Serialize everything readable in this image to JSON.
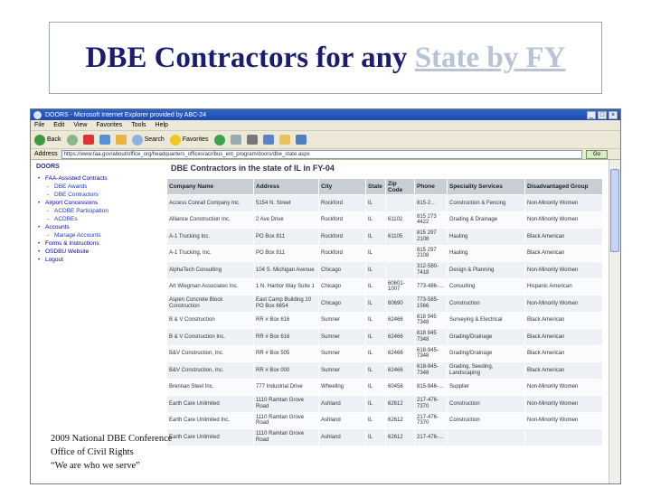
{
  "slide": {
    "title_prefix": "DBE Contractors for any",
    "title_link": "State by FY",
    "footer": [
      "2009 National DBE Conference",
      "Office of Civil Rights",
      "“We are who we serve”"
    ]
  },
  "browser": {
    "window_title": "DOORS - Microsoft Internet Explorer provided by ABC-24",
    "menu": [
      "File",
      "Edit",
      "View",
      "Favorites",
      "Tools",
      "Help"
    ],
    "toolbar": {
      "back": "Back",
      "search": "Search",
      "favorites": "Favorites"
    },
    "address_label": "Address",
    "address": "https://www.faa.gov/about/office_org/headquarters_offices/acr/bus_ent_program/doors/dbe_state.aspx",
    "go_label": "Go"
  },
  "nav": {
    "logo": "DOORS",
    "items": [
      {
        "label": "FAA-Assisted Contracts",
        "sub": false
      },
      {
        "label": "DBE Awards",
        "sub": true
      },
      {
        "label": "DBE Contractors",
        "sub": true
      },
      {
        "label": "Airport Concessions",
        "sub": false
      },
      {
        "label": "ACDBE Participation",
        "sub": true
      },
      {
        "label": "ACDBEs",
        "sub": true
      },
      {
        "label": "Accounts",
        "sub": false
      },
      {
        "label": "Manage Accounts",
        "sub": true
      },
      {
        "label": "Forms & Instructions",
        "sub": false
      },
      {
        "label": "OSDBU Website",
        "sub": false
      },
      {
        "label": "Logout",
        "sub": false
      }
    ]
  },
  "page_heading": "DBE Contractors in the state of IL in FY-04",
  "table": {
    "headers": [
      "Company Name",
      "Address",
      "City",
      "State",
      "Zip Code",
      "Phone",
      "Speciality Services",
      "Disadvantaged Group"
    ],
    "rows": [
      [
        "Access Conrail Company Inc.",
        "5154 N. Street",
        "Rockford",
        "IL",
        "",
        "815-2…",
        "Construction & Fencing",
        "Non-Minority Women"
      ],
      [
        "Alliance Construction Inc.",
        "2 Ave Drive",
        "Rockford",
        "IL",
        "61102",
        "815 273 4422",
        "Grading & Drainage",
        "Non-Minority Women"
      ],
      [
        "A-1 Trucking Inc.",
        "PO Box 811",
        "Rockford",
        "IL",
        "61105",
        "815 297 2108",
        "Hauling",
        "Black American"
      ],
      [
        "A-1 Trucking, Inc.",
        "PO Box 811",
        "Rockford",
        "IL",
        "",
        "815 297 2108",
        "Hauling",
        "Black American"
      ],
      [
        "AlphaTech Consulting",
        "104 S. Michigan Avenue",
        "Chicago",
        "IL",
        "",
        "312-580-7418",
        "Design & Planning",
        "Non-Minority Women"
      ],
      [
        "Art Wiegman Associates Inc.",
        "1 N. Harbor Way Suite 1",
        "Chicago",
        "IL",
        "60601-1007",
        "773-486-…",
        "Consulting",
        "Hispanic American"
      ],
      [
        "Aspen Concrete Block Construction",
        "East Camp Building 10 PO Box 6654",
        "Chicago",
        "IL",
        "60690",
        "773-585-1566",
        "Construction",
        "Non-Minority Women"
      ],
      [
        "B & V Construction",
        "RR # Box 616",
        "Sumner",
        "IL",
        "62466",
        "618 945 7348",
        "Surveying & Electrical",
        "Black American"
      ],
      [
        "B & V Construction Inc.",
        "RR # Box 616",
        "Sumner",
        "IL",
        "62466",
        "618 945 7348",
        "Grading/Drainage",
        "Black American"
      ],
      [
        "B&V Construction, Inc.",
        "RR # Box 505",
        "Sumner",
        "IL",
        "62466",
        "618-945-7348",
        "Grading/Drainage",
        "Black American"
      ],
      [
        "B&V Construction, Inc.",
        "RR # Box 000",
        "Sumner",
        "IL",
        "62466",
        "618-945-7348",
        "Grading, Seeding, Landscaping",
        "Black American"
      ],
      [
        "Brennan Steel Inc.",
        "777 Industrial Drive",
        "Wheeling",
        "IL",
        "60456",
        "815-946-…",
        "Supplier",
        "Non-Minority Women"
      ],
      [
        "Earth Care Unlimited",
        "1110 Ramtan Grove Road",
        "Ashland",
        "IL",
        "62612",
        "217-476-7370",
        "Construction",
        "Non-Minority Women"
      ],
      [
        "Earth Care Unlimited Inc.",
        "1110 Ramtan Grove Road",
        "Ashland",
        "IL",
        "62612",
        "217-476-7370",
        "Construction",
        "Non-Minority Women"
      ],
      [
        "Earth Care Unlimited",
        "1110 Ramtan Grove Road",
        "Ashland",
        "IL",
        "62612",
        "217-476-…",
        "",
        ""
      ]
    ]
  },
  "colors": {
    "title": "#1c1c6e",
    "link": "#b9c3d6",
    "nav_link": "#0000a8",
    "header_bg": "#c9cdd4"
  }
}
